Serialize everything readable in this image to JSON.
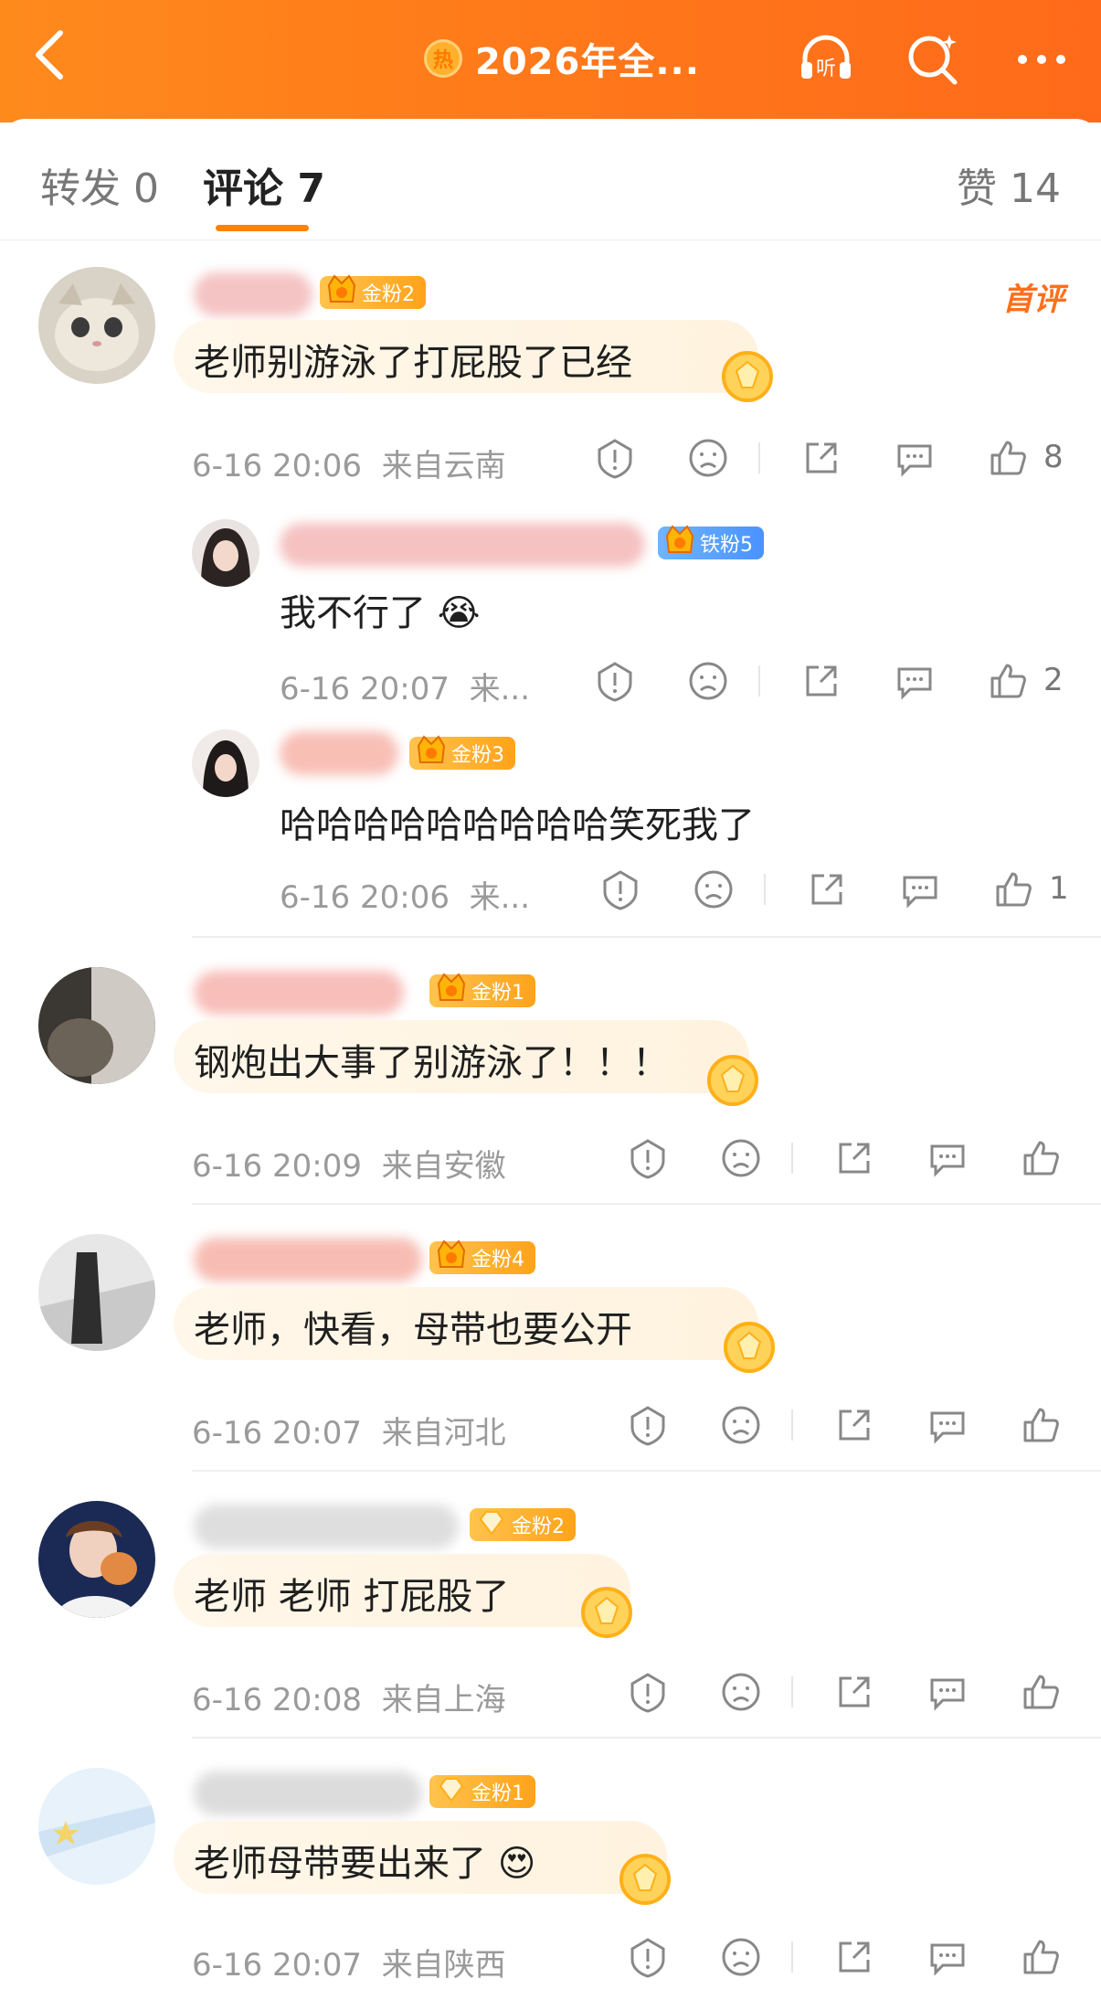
{
  "header": {
    "title": "2026年全...",
    "hot_label": "热",
    "listen_label": "听"
  },
  "tabs": [
    {
      "label": "转发",
      "count": "0"
    },
    {
      "label": "评论",
      "count": "7"
    },
    {
      "label": "赞",
      "count": "14"
    }
  ],
  "first_comment_tag": "首评",
  "comments": [
    {
      "badge": "金粉2",
      "badge_type": "gold",
      "text": "老师别游泳了打屁股了已经",
      "time": "6-16 20:06",
      "location": "来自云南",
      "likes": "8",
      "replies": [
        {
          "badge": "铁粉5",
          "badge_type": "iron",
          "text": "我不行了",
          "emoji": "😭",
          "time": "6-16 20:07",
          "location": "来...",
          "likes": "2"
        },
        {
          "badge": "金粉3",
          "badge_type": "gold",
          "text": "哈哈哈哈哈哈哈哈哈笑死我了",
          "emoji": "",
          "time": "6-16 20:06",
          "location": "来...",
          "likes": "1"
        }
      ]
    },
    {
      "badge": "金粉1",
      "badge_type": "gold",
      "text": "钢炮出大事了别游泳了！！！",
      "time": "6-16 20:09",
      "location": "来自安徽",
      "likes": ""
    },
    {
      "badge": "金粉4",
      "badge_type": "gold",
      "text": "老师，快看，母带也要公开",
      "time": "6-16 20:07",
      "location": "来自河北",
      "likes": ""
    },
    {
      "badge": "金粉2",
      "badge_type": "gold",
      "text": "老师 老师 打屁股了",
      "time": "6-16 20:08",
      "location": "来自上海",
      "likes": ""
    },
    {
      "badge": "金粉1",
      "badge_type": "gold",
      "text": "老师母带要出来了",
      "emoji": "😍",
      "time": "6-16 20:07",
      "location": "来自陕西",
      "likes": ""
    }
  ],
  "colors": {
    "accent": "#ff8200",
    "header_gradient_start": "#ff8a1c",
    "header_gradient_end": "#ff6a1a",
    "gold_badge": "#ffa31a",
    "iron_badge": "#4a92ff"
  }
}
